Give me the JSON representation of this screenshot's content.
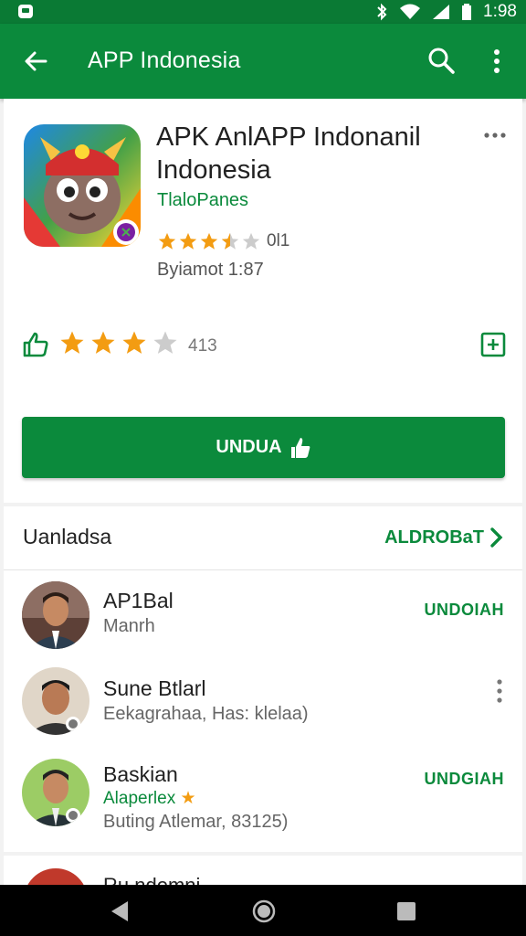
{
  "status_bar": {
    "time": "1:98",
    "icons": [
      "notification-icon",
      "bluetooth-icon",
      "wifi-icon",
      "signal-icon",
      "battery-icon"
    ]
  },
  "app_bar": {
    "title": "APP Indonesia",
    "icons": [
      "back-arrow-icon",
      "search-icon",
      "more-vert-icon"
    ]
  },
  "app": {
    "title": "APK AnlAPP Indonanil Indonesia",
    "developer": "TlaloPanes",
    "rating_count": "0l1",
    "meta": "Byiamot 1:87",
    "rating_stars": 3.5
  },
  "reviews": {
    "stars": 3,
    "count": "413",
    "icons": [
      "thumb-up-outline-icon",
      "add-box-icon"
    ]
  },
  "install_button": {
    "label": "UNDUA"
  },
  "section": {
    "title": "Uanladsa",
    "link_label": "ALDROBaT"
  },
  "items": [
    {
      "name": "AP1Bal",
      "sub": "Manrh",
      "action": "UNDOIAH"
    },
    {
      "name": "Sune Btlarl",
      "sub": "Eekagrahaa, Has: klelaa)"
    },
    {
      "name": "Baskian",
      "sub_green": "Alaperlex",
      "sub": "Buting Atlemar, 83125)",
      "action": "UNDGIAH"
    }
  ],
  "partial_item": {
    "name": "Ru.ndemni"
  },
  "colors": {
    "primary": "#0b8a3c",
    "status_bar": "#0a7a34",
    "star": "#f39c12",
    "star_empty": "#cccccc"
  }
}
